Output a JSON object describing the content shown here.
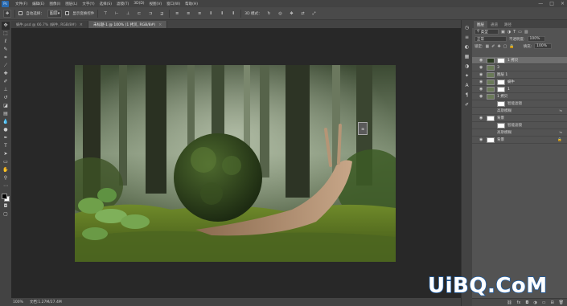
{
  "menubar": {
    "items": [
      "文件(F)",
      "编辑(E)",
      "图像(I)",
      "图层(L)",
      "文字(Y)",
      "选择(S)",
      "滤镜(T)",
      "3D(D)",
      "视图(V)",
      "窗口(W)",
      "帮助(H)"
    ],
    "window_controls": [
      "—",
      "□",
      "×"
    ]
  },
  "optionsbar": {
    "auto_select_label": "自动选择：",
    "auto_select_value": "图层",
    "show_transform_label": "显示变换控件",
    "mode_3d_label": "3D 模式："
  },
  "tabs": [
    {
      "label": "蜗牛.psd @ 66.7% (蜗牛, RGB/8#)",
      "active": false
    },
    {
      "label": "未标题-1 @ 100% (1 拷贝, RGB/8#)",
      "active": true
    }
  ],
  "toolbar": {
    "tools": [
      "move-tool",
      "marquee-tool",
      "lasso-tool",
      "quick-select-tool",
      "crop-tool",
      "eyedropper-tool",
      "healing-tool",
      "brush-tool",
      "stamp-tool",
      "history-brush-tool",
      "eraser-tool",
      "gradient-tool",
      "blur-tool",
      "dodge-tool",
      "pen-tool",
      "type-tool",
      "path-select-tool",
      "shape-tool",
      "hand-tool",
      "zoom-tool",
      "more-tools"
    ]
  },
  "statusbar": {
    "zoom": "100%",
    "doc_info": "文档:1.27M/27.4M"
  },
  "panel": {
    "tabs": [
      "图层",
      "通道",
      "路径"
    ],
    "kind_label": "类型",
    "blend_mode": "正常",
    "opacity_label": "不透明度:",
    "opacity_value": "100%",
    "lock_label": "锁定:",
    "fill_label": "填充:",
    "fill_value": "100%",
    "layers": [
      {
        "name": "1 拷贝",
        "selected": true,
        "sub": false,
        "has_mask": true,
        "fx": ""
      },
      {
        "name": "3",
        "selected": false,
        "sub": false,
        "has_mask": false,
        "fx": ""
      },
      {
        "name": "图层 1",
        "selected": false,
        "sub": false,
        "has_mask": false,
        "fx": ""
      },
      {
        "name": "蜗牛",
        "selected": false,
        "sub": false,
        "has_mask": true,
        "fx": ""
      },
      {
        "name": "1",
        "selected": false,
        "sub": false,
        "has_mask": true,
        "fx": ""
      },
      {
        "name": "1 拷贝",
        "selected": false,
        "sub": false,
        "has_mask": false,
        "fx": ""
      },
      {
        "name": "智能滤镜",
        "selected": false,
        "sub": true,
        "has_mask": true,
        "fx": ""
      },
      {
        "name": "高斯模糊",
        "selected": false,
        "sub": true,
        "has_mask": false,
        "fx": "≒"
      },
      {
        "name": "背景",
        "selected": false,
        "sub": false,
        "has_mask": false,
        "fx": ""
      },
      {
        "name": "智能滤镜",
        "selected": false,
        "sub": true,
        "has_mask": true,
        "fx": ""
      },
      {
        "name": "高斯模糊",
        "selected": false,
        "sub": true,
        "has_mask": false,
        "fx": "≒"
      },
      {
        "name": "背景",
        "selected": false,
        "sub": false,
        "has_mask": false,
        "fx": "🔒"
      }
    ],
    "footer_icons": [
      "link-icon",
      "fx-icon",
      "mask-icon",
      "adjustment-icon",
      "group-icon",
      "new-layer-icon",
      "trash-icon"
    ]
  },
  "watermark": {
    "text": "UiBQ.CoM"
  },
  "colors": {
    "accent": "#1e5fa8",
    "canvas_bg": "#282828"
  }
}
